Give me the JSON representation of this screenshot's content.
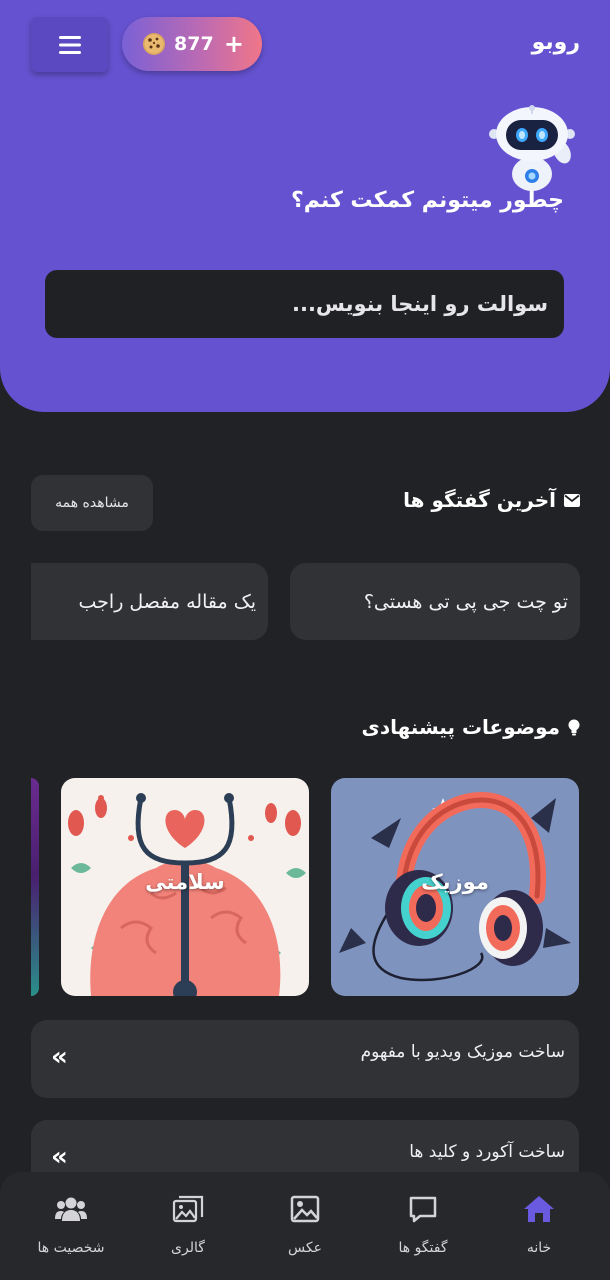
{
  "header": {
    "brand": "روبو",
    "coins": "877",
    "add_symbol": "+",
    "prompt_title": "چطور میتونم کمکت کنم؟",
    "input_placeholder": "سوالت رو اینجا بنویس...",
    "accent_color": "#6552d0"
  },
  "recent_chats": {
    "title": "آخرین گفتگو ها",
    "title_icon": "envelope-icon",
    "see_all_label": "مشاهده همه",
    "items": [
      {
        "label": "تو چت جی پی تی هستی؟"
      },
      {
        "label": "یک مقاله مفصل راجب"
      }
    ]
  },
  "suggested_topics": {
    "title": "موضوعات پیشنهادی",
    "title_icon": "lightbulb-icon",
    "cards": [
      {
        "label": "موزیک",
        "icon": "headphones-illustration"
      },
      {
        "label": "سلامتی",
        "icon": "brain-stethoscope-illustration"
      }
    ]
  },
  "prompts": {
    "arrow_symbol": "«",
    "items": [
      {
        "label": "ساخت موزیک ویدیو با مفهوم"
      },
      {
        "label": "ساخت آکورد و کلید ها"
      }
    ]
  },
  "bottom_nav": {
    "active_color": "#6a5ae0",
    "items": [
      {
        "label": "خانه",
        "icon": "home-icon",
        "active": true
      },
      {
        "label": "گفتگو ها",
        "icon": "chat-icon",
        "active": false
      },
      {
        "label": "عکس",
        "icon": "image-icon",
        "active": false
      },
      {
        "label": "گالری",
        "icon": "gallery-icon",
        "active": false
      },
      {
        "label": "شخصیت ها",
        "icon": "users-icon",
        "active": false
      }
    ]
  }
}
